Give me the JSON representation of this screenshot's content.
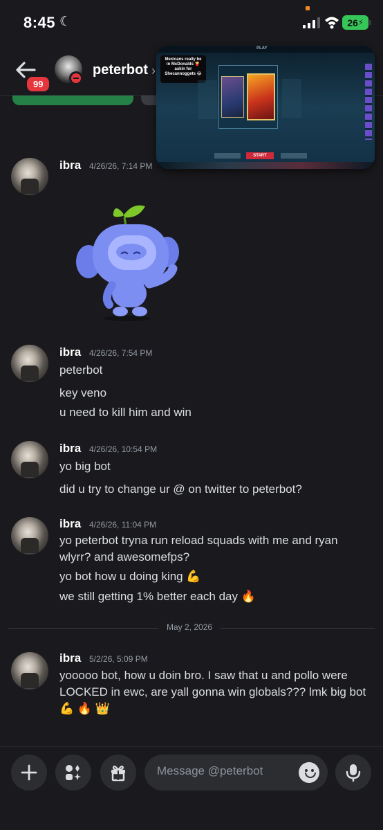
{
  "status_bar": {
    "time": "8:45",
    "battery": "26"
  },
  "header": {
    "badge_count": "99",
    "username": "peterbot",
    "chevron": "›"
  },
  "pip_overlay": {
    "top_label": "PLAY",
    "notification": "Mexicans really be in McDonalds 🍟 askin for Shecannoggets 😂",
    "start_label": "START"
  },
  "messages": [
    {
      "author": "ibra",
      "timestamp": "4/26/26, 7:14 PM",
      "lines": []
    },
    {
      "author": "ibra",
      "timestamp": "4/26/26, 7:54 PM",
      "lines": [
        "peterbot",
        "key veno",
        "u need to kill him and win"
      ]
    },
    {
      "author": "ibra",
      "timestamp": "4/26/26, 10:54 PM",
      "lines": [
        "yo big bot",
        "did u try to change ur @ on twitter to peterbot?"
      ]
    },
    {
      "author": "ibra",
      "timestamp": "4/26/26, 11:04 PM",
      "lines": [
        "yo peterbot tryna run reload squads with me and ryan wlyrr? and awesomefps?",
        "yo bot how u doing king 💪",
        "we still getting 1% better each day 🔥"
      ]
    },
    {
      "author": "ibra",
      "timestamp": "5/2/26, 5:09 PM",
      "lines": [
        "yooooo bot, how u doin bro. I saw that u and pollo were LOCKED in ewc, are yall gonna win globals??? lmk big bot 💪 🔥 👑"
      ]
    }
  ],
  "date_divider": "May 2, 2026",
  "composer": {
    "placeholder": "Message @peterbot"
  },
  "colors": {
    "background": "#1a1a1e",
    "accent_red": "#e5363d",
    "battery_green": "#36c759",
    "input_bg": "#2b2d31"
  }
}
